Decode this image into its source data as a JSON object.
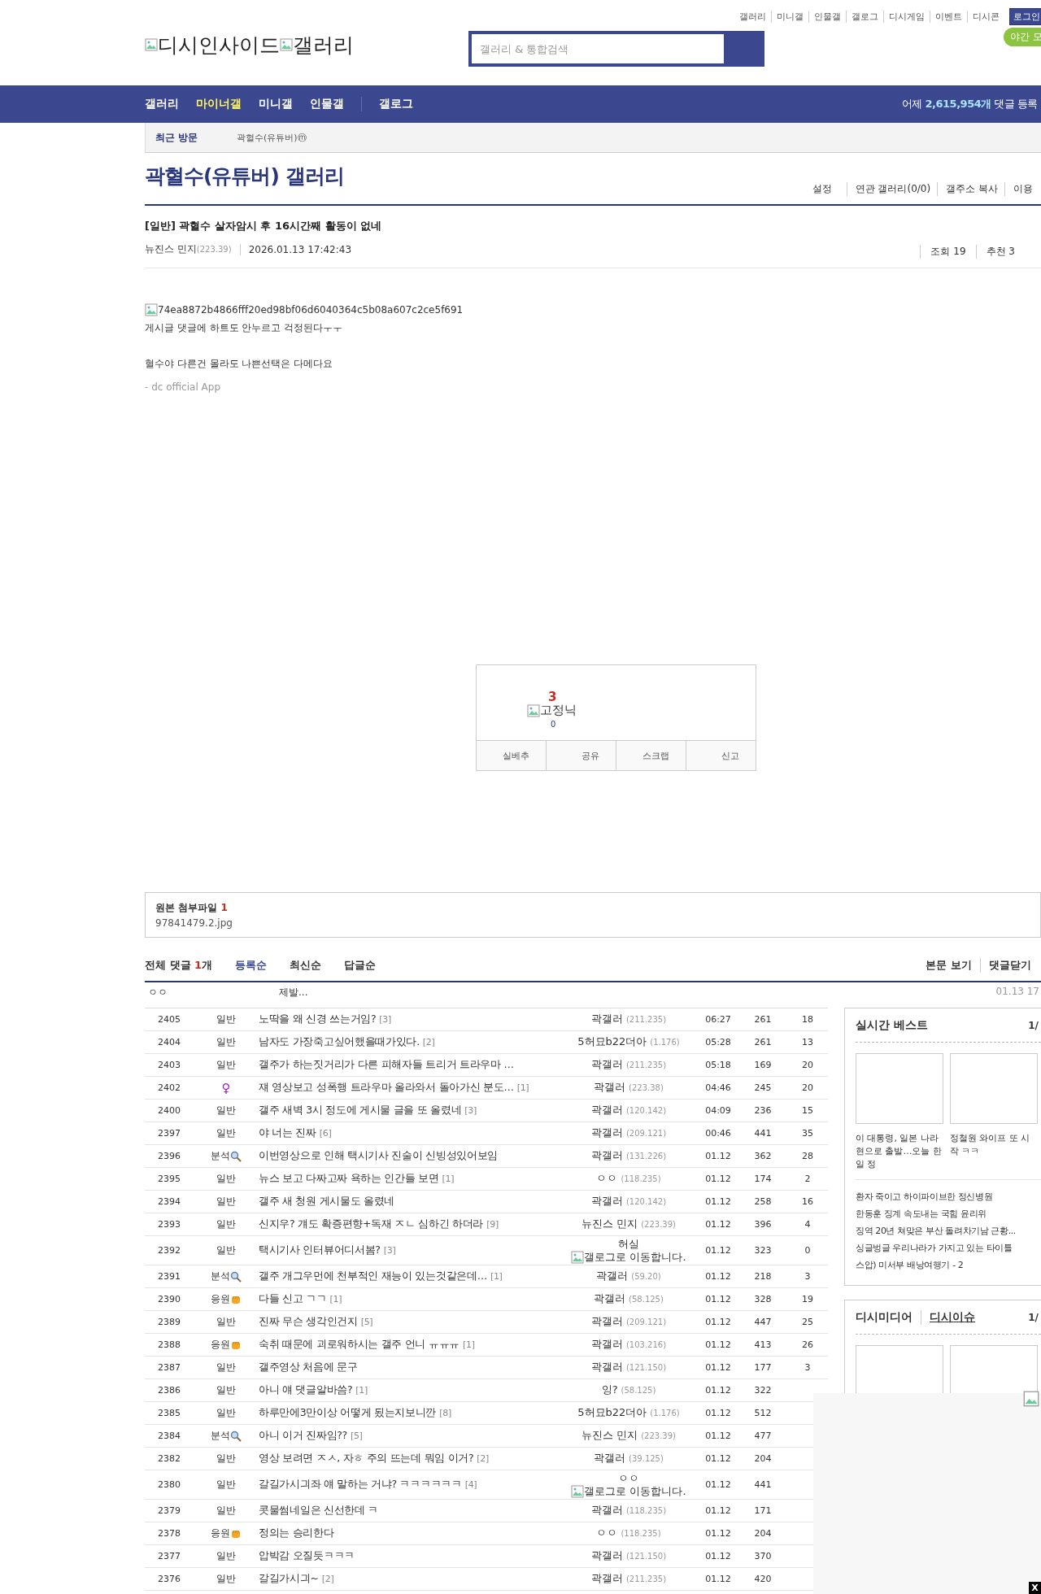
{
  "top_links": [
    "갤러리",
    "미니갤",
    "인물갤",
    "갤로그",
    "디시게임",
    "이벤트",
    "디시콘"
  ],
  "login": "로그인",
  "night_mode": "야간 모",
  "logo": [
    "디시인사이드",
    "갤러리"
  ],
  "search": {
    "placeholder": "갤러리 & 통합검색"
  },
  "nav": [
    {
      "label": "갤러리",
      "selected": false
    },
    {
      "label": "마이너갤",
      "selected": true
    },
    {
      "label": "미니갤",
      "selected": false
    },
    {
      "label": "인물갤",
      "selected": false
    },
    {
      "label": "갤로그",
      "selected": false
    }
  ],
  "nav_stats": {
    "prefix": "어제",
    "count": "2,615,954개",
    "suffix": "댓글 등록"
  },
  "recent": {
    "label": "최근 방문",
    "items": [
      {
        "name": "곽혈수(유튜버)",
        "badge": "ⓜ"
      }
    ]
  },
  "gallery": {
    "title": "곽혈수(유튜버) 갤러리",
    "tools": [
      "설정",
      "연관 갤러리(0/0)",
      "갤주소 복사",
      "이용"
    ]
  },
  "post": {
    "title": "[일반] 곽혈수 살자암시 후 16시간째 활동이 없네",
    "author": "뉴진스 민지",
    "ip": "(223.39)",
    "date": "2026.01.13 17:42:43",
    "views": "조회 19",
    "recs": "추천 3",
    "image_alt": "74ea8872b4866fff20ed98bf06d6040364c5b08a607c2ce5f691",
    "lines": [
      "게시글 댓글에 하트도 안누르고 걱정된다ㅜㅜ",
      "혈수야 다른건 몰라도 나쁜선택은 다메다요"
    ],
    "footer": "- dc official App"
  },
  "recommend": {
    "count": "3",
    "fixed_alt": "고정닉",
    "fixed_count": "0",
    "buttons": [
      "실베추",
      "공유",
      "스크랩",
      "신고"
    ]
  },
  "attachment": {
    "label": "원본 첨부파일",
    "count": "1",
    "file": "97841479.2.jpg"
  },
  "comments": {
    "label": "전체 댓글",
    "count": "1",
    "unit": "개",
    "sorts": [
      {
        "label": "등록순",
        "selected": true
      },
      {
        "label": "최신순",
        "selected": false
      },
      {
        "label": "답글순",
        "selected": false
      }
    ],
    "tools": [
      "본문 보기",
      "댓글닫기"
    ],
    "items": [
      {
        "writer": "ㅇㅇ",
        "text": "제발...",
        "date": "01.13 17"
      }
    ]
  },
  "rows": [
    {
      "no": "2405",
      "cat": "일반",
      "kind": "plain",
      "title": "노딱을 왜 신경 쓰는거임?",
      "reply": "[3]",
      "writer": "곽갤러",
      "ip": "(211.235)",
      "date": "06:27",
      "views": "261",
      "recs": "18"
    },
    {
      "no": "2404",
      "cat": "일반",
      "kind": "plain",
      "title": "남자도 가장죽고싶어했을때가있다.",
      "reply": "[2]",
      "writer": "5허묘b22더아",
      "ip": "(1.176)",
      "date": "05:28",
      "views": "261",
      "recs": "13"
    },
    {
      "no": "2403",
      "cat": "일반",
      "kind": "plain",
      "title": "갤주가 하는짓거리가 다른 피해자들 트리거 트라우마 …",
      "writer": "곽갤러",
      "ip": "(211.235)",
      "date": "05:18",
      "views": "169",
      "recs": "20"
    },
    {
      "no": "2402",
      "cat": "♀",
      "kind": "female",
      "title": "쟤 영상보고 성폭행 트라우마 올라와서 돌아가신 분도…",
      "reply": "[1]",
      "writer": "곽갤러",
      "ip": "(223.38)",
      "date": "04:46",
      "views": "245",
      "recs": "20"
    },
    {
      "no": "2400",
      "cat": "일반",
      "kind": "plain",
      "title": "갤주 새벽 3시 정도에 게시물 글을 또 올렸네",
      "reply": "[3]",
      "writer": "곽갤러",
      "ip": "(120.142)",
      "date": "04:09",
      "views": "236",
      "recs": "15"
    },
    {
      "no": "2397",
      "cat": "일반",
      "kind": "plain",
      "title": "야 너는 진짜",
      "reply": "[6]",
      "writer": "곽갤러",
      "ip": "(209.121)",
      "date": "00:46",
      "views": "441",
      "recs": "35"
    },
    {
      "no": "2396",
      "cat": "분석",
      "kind": "search",
      "title": "이번영상으로 인해 택시기사 진술이 신빙성있어보임",
      "writer": "곽갤러",
      "ip": "(131.226)",
      "date": "01.12",
      "views": "362",
      "recs": "28"
    },
    {
      "no": "2395",
      "cat": "일반",
      "kind": "plain",
      "title": "뉴스 보고 다짜고짜 욕하는 인간들 보면",
      "reply": "[1]",
      "writer": "ㅇㅇ",
      "ip": "(118.235)",
      "date": "01.12",
      "views": "174",
      "recs": "2"
    },
    {
      "no": "2394",
      "cat": "일반",
      "kind": "plain",
      "title": "갤주 새 청원 게시물도 올렸네",
      "writer": "곽갤러",
      "ip": "(120.142)",
      "date": "01.12",
      "views": "258",
      "recs": "16"
    },
    {
      "no": "2393",
      "cat": "일반",
      "kind": "plain",
      "title": "신지우? 걔도 확증편향+독재 ㅈㄴ 심하긴 하더라",
      "reply": "[9]",
      "writer": "뉴진스 민지",
      "ip": "(223.39)",
      "date": "01.12",
      "views": "396",
      "recs": "4"
    },
    {
      "no": "2392",
      "cat": "일반",
      "kind": "plain",
      "title": "택시기사 인터뷰어디서봄?",
      "reply": "[3]",
      "writer": "허실",
      "gallog": "갤로그로 이동합니다.",
      "date": "01.12",
      "views": "323",
      "recs": "0"
    },
    {
      "no": "2391",
      "cat": "분석",
      "kind": "search",
      "title": "갤주 개그우먼에 천부적인 재능이 있는것같은데…",
      "reply": "[1]",
      "writer": "곽갤러",
      "ip": "(59.20)",
      "date": "01.12",
      "views": "218",
      "recs": "3"
    },
    {
      "no": "2390",
      "cat": "응원",
      "kind": "fist",
      "title": "다들 신고 ㄱㄱ",
      "reply": "[1]",
      "writer": "곽갤러",
      "ip": "(58.125)",
      "date": "01.12",
      "views": "328",
      "recs": "19"
    },
    {
      "no": "2389",
      "cat": "일반",
      "kind": "plain",
      "title": "진짜 무슨 생각인건지",
      "reply": "[5]",
      "writer": "곽갤러",
      "ip": "(209.121)",
      "date": "01.12",
      "views": "447",
      "recs": "25"
    },
    {
      "no": "2388",
      "cat": "응원",
      "kind": "fist",
      "title": "숙취 때문에 괴로워하시는 갤주 언니 ㅠㅠㅠ",
      "reply": "[1]",
      "writer": "곽갤러",
      "ip": "(103.216)",
      "date": "01.12",
      "views": "413",
      "recs": "26"
    },
    {
      "no": "2387",
      "cat": "일반",
      "kind": "plain",
      "title": "갤주영상 처음에 문구",
      "writer": "곽갤러",
      "ip": "(121.150)",
      "date": "01.12",
      "views": "177",
      "recs": "3"
    },
    {
      "no": "2386",
      "cat": "일반",
      "kind": "plain",
      "title": "아니 얘 댓글알바씀?",
      "reply": "[1]",
      "writer": "잉?",
      "ip": "(58.125)",
      "date": "01.12",
      "views": "322"
    },
    {
      "no": "2385",
      "cat": "일반",
      "kind": "plain",
      "title": "하루만에3만이상 어떻게 됬는지보니깐",
      "reply": "[8]",
      "writer": "5허묘b22더아",
      "ip": "(1.176)",
      "date": "01.12",
      "views": "512"
    },
    {
      "no": "2384",
      "cat": "분석",
      "kind": "search",
      "title": "아니 이거 진짜임??",
      "reply": "[5]",
      "writer": "뉴진스 민지",
      "ip": "(223.39)",
      "date": "01.12",
      "views": "477"
    },
    {
      "no": "2382",
      "cat": "일반",
      "kind": "plain",
      "title": "영상 보려면 ㅈㅅ, 자ㅎ 주의 뜨는데 뭐임 이거?",
      "reply": "[2]",
      "writer": "곽갤러",
      "ip": "(39.125)",
      "date": "01.12",
      "views": "204"
    },
    {
      "no": "2380",
      "cat": "일반",
      "kind": "plain",
      "title": "갈길가시긔좌 얘 말하는 거냐? ㅋㅋㅋㅋㅋㅋ",
      "reply": "[4]",
      "writer": "ㅇㅇ",
      "gallog": "갤로그로 이동합니다.",
      "date": "01.12",
      "views": "441"
    },
    {
      "no": "2379",
      "cat": "일반",
      "kind": "plain",
      "title": "콧물썸네일은 신선한데 ㅋ",
      "writer": "곽갤러",
      "ip": "(118.235)",
      "date": "01.12",
      "views": "171"
    },
    {
      "no": "2378",
      "cat": "응원",
      "kind": "fist",
      "title": "정의는 승리한다",
      "writer": "ㅇㅇ",
      "ip": "(118.235)",
      "date": "01.12",
      "views": "204"
    },
    {
      "no": "2377",
      "cat": "일반",
      "kind": "plain",
      "title": "압박감 오질듯ㅋㅋㅋ",
      "writer": "곽갤러",
      "ip": "(121.150)",
      "date": "01.12",
      "views": "370"
    },
    {
      "no": "2376",
      "cat": "일반",
      "kind": "plain",
      "title": "갈길가시긔~",
      "reply": "[2]",
      "writer": "곽갤러",
      "ip": "(211.235)",
      "date": "01.12",
      "views": "420"
    }
  ],
  "best": {
    "title": "실시간 베스트",
    "page": "1/",
    "cards": [
      "이 대통령, 일본 나라현으로 출발…오늘 한일 정",
      "정철원 와이프 또 시작 ㅋㅋ"
    ],
    "list": [
      "환자 죽이고 하이파이브한 정신병원",
      "한동훈 징계 속도내는 국힘 윤리위",
      "징역 20년 쳐맞은 부산 돌려차기남 근황...",
      "싱글벙글 우리나라가 가지고 있는 타이틀",
      "스압) 미서부 배낭여행기 - 2"
    ]
  },
  "media": {
    "tabs": [
      {
        "label": "디시미디어",
        "selected": false
      },
      {
        "label": "디시이슈",
        "selected": true
      }
    ],
    "page": "1/"
  },
  "ad": {
    "close": "X"
  }
}
